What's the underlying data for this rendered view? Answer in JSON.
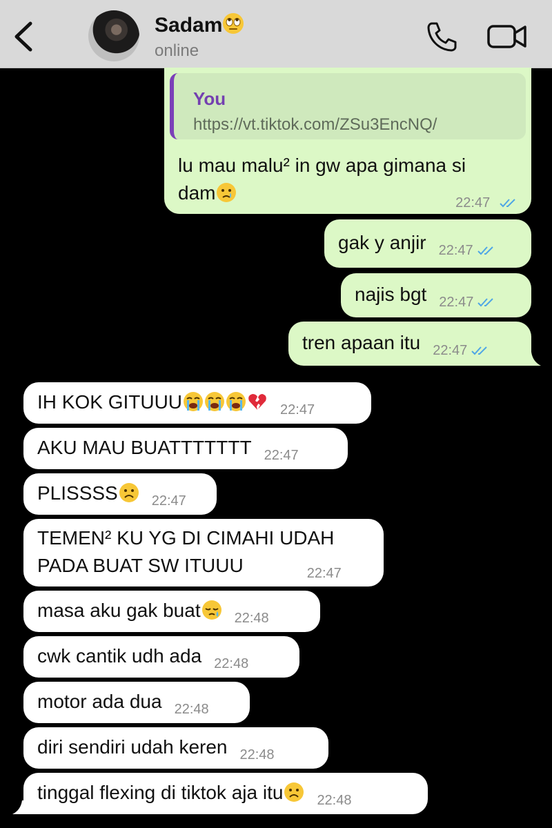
{
  "header": {
    "contact_name": "Sadam",
    "contact_status": "online"
  },
  "icons": {
    "back": "chevron-left-icon",
    "call": "phone-icon",
    "video": "video-camera-icon"
  },
  "colors": {
    "outgoing_bubble": "#dcf8c6",
    "incoming_bubble": "#ffffff",
    "quote_accent": "#7b3fb8",
    "read_ticks": "#4fa6e6",
    "background": "#000000"
  },
  "messages": [
    {
      "direction": "out",
      "quote": {
        "sender": "You",
        "text": "https://vt.tiktok.com/ZSu3EncNQ/"
      },
      "line1": "lu mau malu² in gw apa gimana si",
      "line2": "dam",
      "emoji": "crying-face",
      "time": "22:47",
      "status": "read"
    },
    {
      "direction": "out",
      "text": "gak y anjir",
      "time": "22:47",
      "status": "read"
    },
    {
      "direction": "out",
      "text": "najis bgt",
      "time": "22:47",
      "status": "read"
    },
    {
      "direction": "out",
      "text": "tren apaan itu",
      "time": "22:47",
      "status": "read"
    },
    {
      "direction": "in",
      "text": "IH KOK GITUUU",
      "emojis": [
        "loudly-crying-face",
        "loudly-crying-face",
        "loudly-crying-face",
        "broken-heart"
      ],
      "time": "22:47"
    },
    {
      "direction": "in",
      "text": "AKU MAU BUATTTTTTT",
      "time": "22:47"
    },
    {
      "direction": "in",
      "text": "PLISSSS",
      "emojis": [
        "frowning-face"
      ],
      "time": "22:47"
    },
    {
      "direction": "in",
      "line1": "TEMEN² KU YG DI CIMAHI UDAH",
      "line2": "PADA BUAT SW ITUUU",
      "time": "22:47"
    },
    {
      "direction": "in",
      "text": "masa aku gak buat",
      "emojis": [
        "sleepy-face"
      ],
      "time": "22:48"
    },
    {
      "direction": "in",
      "text": "cwk cantik udh ada",
      "time": "22:48"
    },
    {
      "direction": "in",
      "text": "motor ada dua",
      "time": "22:48"
    },
    {
      "direction": "in",
      "text": "diri sendiri udah keren",
      "time": "22:48"
    },
    {
      "direction": "in",
      "text": "tinggal flexing di tiktok aja itu",
      "emojis": [
        "frowning-face"
      ],
      "time": "22:48"
    }
  ]
}
